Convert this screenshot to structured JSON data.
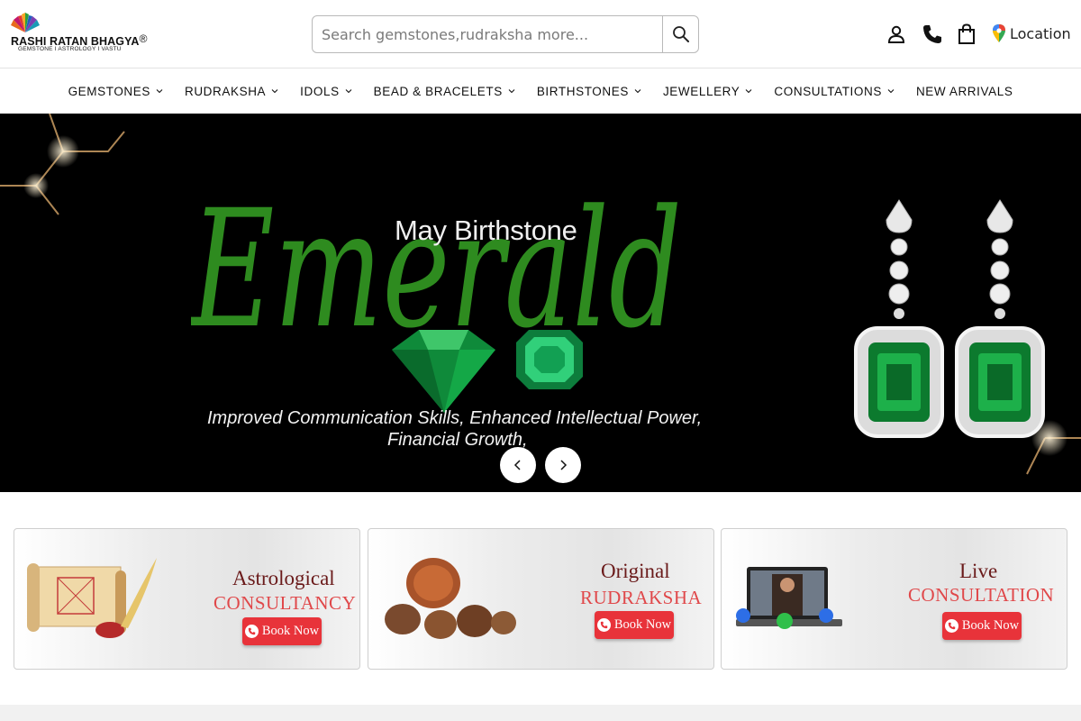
{
  "brand": {
    "name": "RASHI RATAN BHAGYA",
    "registered_mark": "®",
    "tagline": "GEMSTONE I ASTROLOGY I VASTU"
  },
  "search": {
    "placeholder": "Search gemstones,rudraksha more..."
  },
  "header_icons": [
    "account-icon",
    "phone-icon",
    "bag-icon",
    "location-pin-icon"
  ],
  "location_label": "Location",
  "nav": {
    "items": [
      {
        "label": "GEMSTONES",
        "dropdown": true
      },
      {
        "label": "RUDRAKSHA",
        "dropdown": true
      },
      {
        "label": "IDOLS",
        "dropdown": true
      },
      {
        "label": "BEAD & BRACELETS",
        "dropdown": true
      },
      {
        "label": "BIRTHSTONES",
        "dropdown": true
      },
      {
        "label": "JEWELLERY",
        "dropdown": true
      },
      {
        "label": "CONSULTATIONS",
        "dropdown": true
      },
      {
        "label": "NEW ARRIVALS",
        "dropdown": false
      }
    ]
  },
  "hero": {
    "subtitle": "May Birthstone",
    "script_title": "Emerald",
    "description_line1": "Improved Communication Skills, Enhanced Intellectual Power,",
    "description_line2": "Financial Growth,",
    "colors": {
      "background": "#000000",
      "accent_green": "#2e8b1f",
      "emerald": "#0f8a3a"
    }
  },
  "promos": [
    {
      "line1": "Astrological",
      "line2": "CONSULTANCY",
      "button": "Book Now"
    },
    {
      "line1": "Original",
      "line2": "RUDRAKSHA",
      "button": "Book Now"
    },
    {
      "line1": "Live",
      "line2": "CONSULTATION",
      "button": "Book Now"
    }
  ],
  "colors": {
    "book_button": "#e8333a",
    "promo_title": "#6a1a1a",
    "promo_subtitle": "#e0484a"
  }
}
